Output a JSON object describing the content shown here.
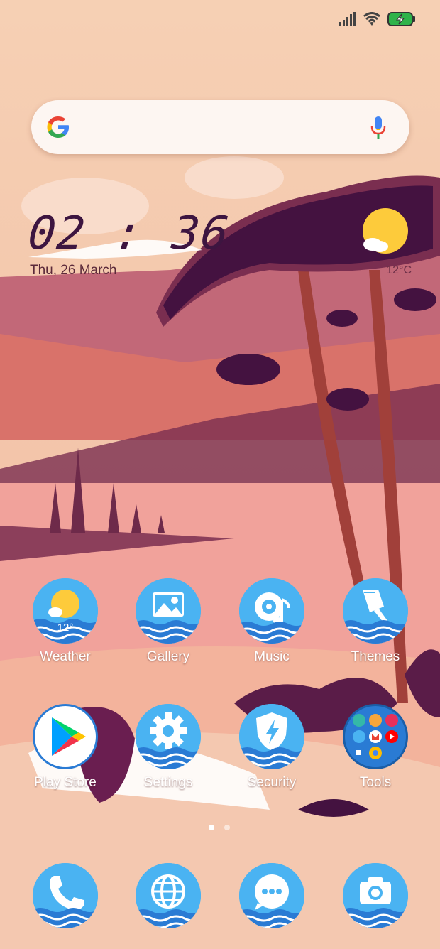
{
  "status_bar": {
    "signal_icon": "cellular-signal-icon",
    "wifi_icon": "wifi-icon",
    "battery_icon": "battery-charging-icon"
  },
  "search_bar": {
    "logo_icon": "google-logo-icon",
    "mic_icon": "microphone-icon"
  },
  "clock_widget": {
    "time": "02 : 36",
    "date": "Thu, 26 March",
    "weather_icon": "sun-cloud-icon",
    "temperature": "12°C"
  },
  "apps_row1": [
    {
      "label": "Weather",
      "icon": "weather-icon",
      "badge": "12°"
    },
    {
      "label": "Gallery",
      "icon": "gallery-icon"
    },
    {
      "label": "Music",
      "icon": "music-icon"
    },
    {
      "label": "Themes",
      "icon": "themes-brush-icon"
    }
  ],
  "apps_row2": [
    {
      "label": "Play Store",
      "icon": "play-store-icon"
    },
    {
      "label": "Settings",
      "icon": "gear-icon"
    },
    {
      "label": "Security",
      "icon": "shield-bolt-icon"
    },
    {
      "label": "Tools",
      "icon": "folder-icon"
    }
  ],
  "dock": [
    {
      "icon": "phone-icon"
    },
    {
      "icon": "browser-globe-icon"
    },
    {
      "icon": "messages-icon"
    },
    {
      "icon": "camera-icon"
    }
  ],
  "page_indicator": {
    "pages": 2,
    "current": 1
  },
  "colors": {
    "icon_blue": "#4ab3f2",
    "wave_blue": "#1e88e5",
    "label": "#ffffff",
    "clock": "#3d1540"
  }
}
